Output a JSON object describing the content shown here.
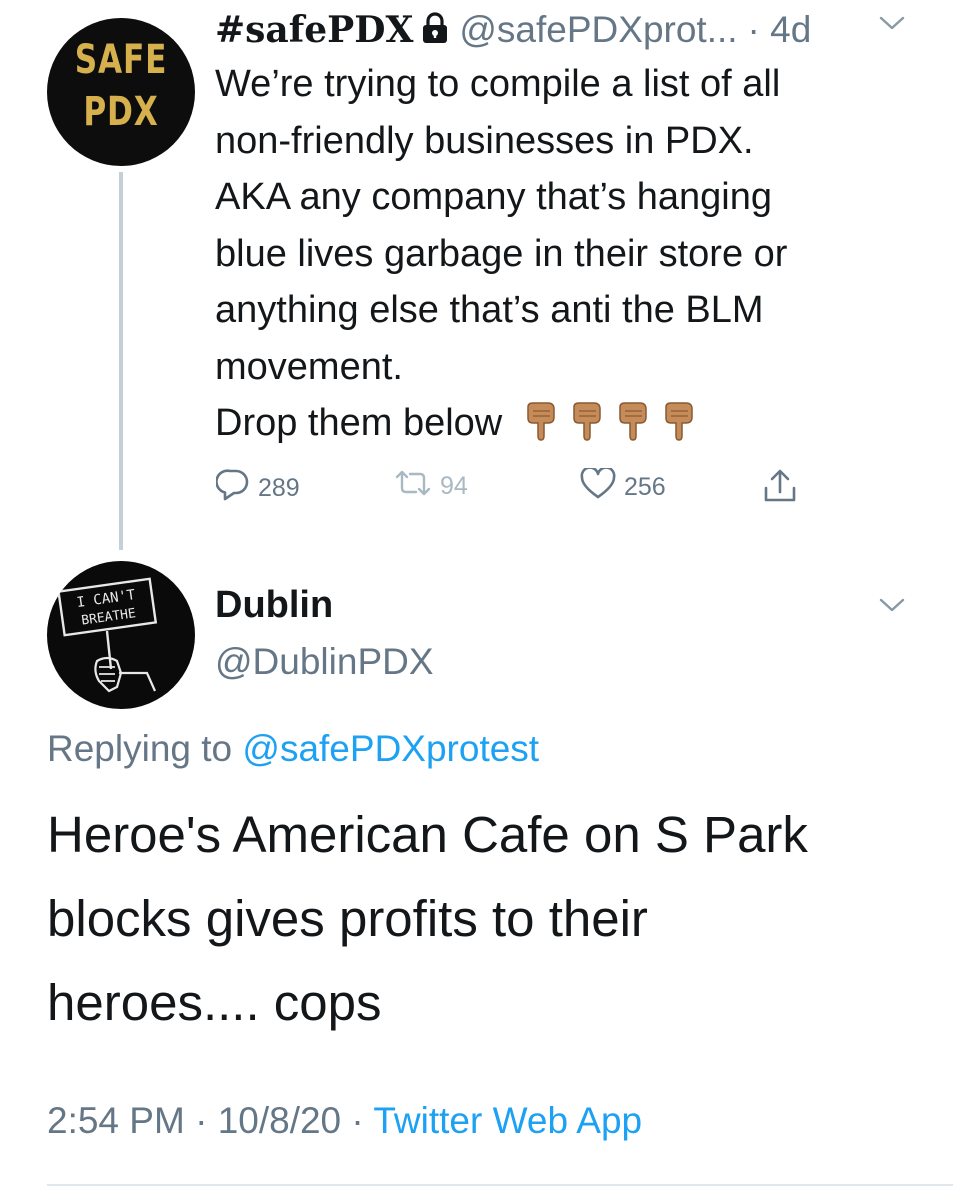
{
  "tweet": {
    "author": {
      "avatar_line1": "SAFE",
      "avatar_line2": "PDX",
      "display_name": "#safePDX",
      "handle": "@safePDXprot...",
      "protected_icon": "lock-icon"
    },
    "time_ago": "· 4d",
    "text_lines": [
      "We’re trying to compile a list of all",
      "non-friendly businesses in PDX.",
      "AKA any company that’s hanging",
      "blue lives garbage in their store or",
      "anything else that’s anti the BLM",
      "movement.",
      "Drop them below"
    ],
    "emoji": [
      "backhand-index-pointing-down",
      "backhand-index-pointing-down",
      "backhand-index-pointing-down",
      "backhand-index-pointing-down"
    ],
    "actions": {
      "replies": "289",
      "retweets": "94",
      "likes": "256"
    }
  },
  "reply": {
    "author": {
      "avatar_sign_line1": "I CAN'T",
      "avatar_sign_line2": "BREATHE",
      "display_name": "Dublin",
      "handle": "@DublinPDX"
    },
    "replying_label": "Replying to",
    "replying_mention": "@safePDXprotest",
    "text_lines": [
      "Heroe's American Cafe on S Park",
      "blocks gives profits to their",
      "heroes.... cops"
    ],
    "time": "2:54 PM",
    "date": "10/8/20",
    "separator": "·",
    "source": "Twitter Web App"
  },
  "colors": {
    "text": "#14171a",
    "secondary": "#657786",
    "link": "#1da1f2",
    "thread_line": "#c4cfd6",
    "avatar_gold": "#d6b04c"
  }
}
